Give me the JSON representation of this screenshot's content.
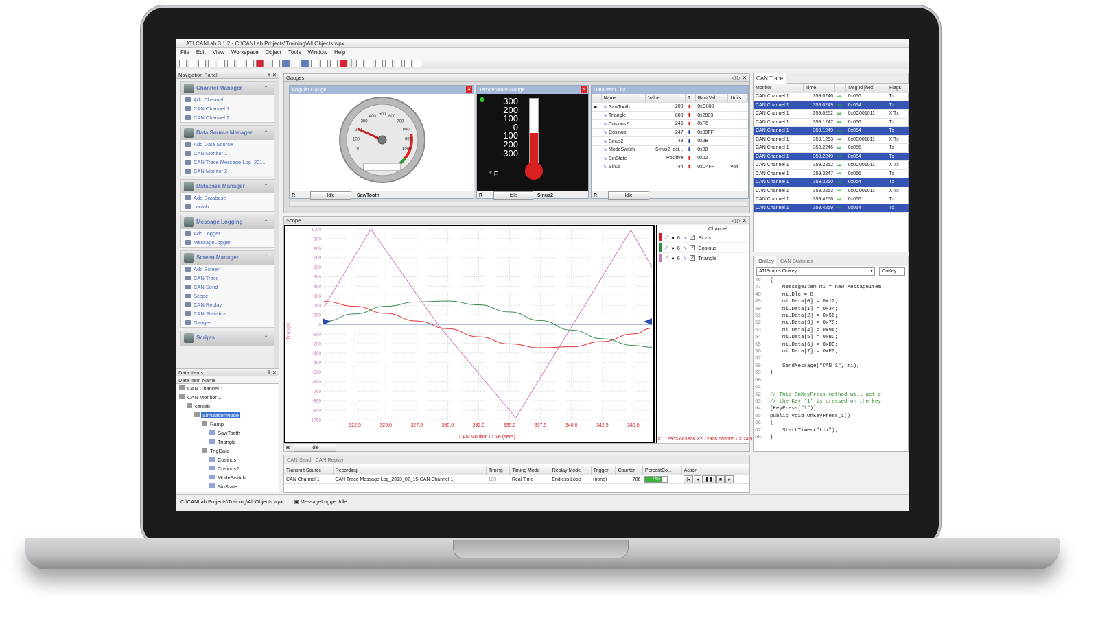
{
  "app": {
    "title": "ATI CANLab 3.1.2 - C:\\CANLab Projects\\Training\\All Objects.wpx",
    "menu": [
      "File",
      "Edit",
      "View",
      "Workspace",
      "Object",
      "Tools",
      "Window",
      "Help"
    ]
  },
  "navigation": {
    "header": "Navigation Panel",
    "sections": [
      {
        "title": "Channel Manager",
        "items": [
          "Add Channel",
          "CAN Channel 1",
          "CAN Channel 2"
        ]
      },
      {
        "title": "Data Source Manager",
        "items": [
          "Add Data Source",
          "CAN Monitor 1",
          "CAN Trace Message Log_201...",
          "CAN Monitor 2"
        ]
      },
      {
        "title": "Database Manager",
        "items": [
          "Add Database",
          "canlab"
        ]
      },
      {
        "title": "Message Logging",
        "items": [
          "Add Logger",
          "MessageLogger"
        ]
      },
      {
        "title": "Screen Manager",
        "items": [
          "Add Screen",
          "CAN Trace",
          "CAN Send",
          "Scope",
          "CAN Replay",
          "CAN Statistics",
          "Gauges"
        ]
      },
      {
        "title": "Scripts",
        "items": []
      }
    ]
  },
  "data_items": {
    "header": "Data Items",
    "column": "Data Item Name",
    "rows": [
      {
        "label": "CAN Channel 1",
        "indent": 0
      },
      {
        "label": "CAN Monitor 1",
        "indent": 0
      },
      {
        "label": "canlab",
        "indent": 1
      },
      {
        "label": "SimulationNode",
        "indent": 2,
        "selected": true
      },
      {
        "label": "Ramp",
        "indent": 3
      },
      {
        "label": "SawTooth",
        "indent": 4
      },
      {
        "label": "Triangle",
        "indent": 4
      },
      {
        "label": "TrigData",
        "indent": 3
      },
      {
        "label": "Cosinus",
        "indent": 4
      },
      {
        "label": "Cosinus2",
        "indent": 4
      },
      {
        "label": "ModeSwitch",
        "indent": 4
      },
      {
        "label": "SinState",
        "indent": 4
      }
    ]
  },
  "gauges": {
    "tab": "Gauges",
    "angular": {
      "title": "Angular Gauge",
      "status_r": "R",
      "status": "Idle",
      "signal": "SawTooth",
      "ticks": [
        "0",
        "100",
        "200",
        "300",
        "400",
        "500",
        "600",
        "700",
        "800",
        "900",
        "1000"
      ],
      "value_fraction": 0.2
    },
    "temperature": {
      "title": "Temperature Gauge",
      "status_r": "R",
      "status": "Idle",
      "signal": "Sinus2",
      "scale": [
        "300",
        "200",
        "100",
        "0",
        "-100",
        "-200",
        "-300"
      ],
      "unit": "° F",
      "value_fraction": 0.58
    },
    "data_item_list": {
      "title": "Data Item List",
      "columns": [
        "Name",
        "Value",
        "T",
        "Raw Val...",
        "Units"
      ],
      "rows": [
        {
          "name": "SawTooth",
          "value": "200",
          "dir": "up",
          "raw": "0xC800",
          "units": ""
        },
        {
          "name": "Triangle",
          "value": "800",
          "dir": "up",
          "raw": "0x2003",
          "units": ""
        },
        {
          "name": "Cosinus2",
          "value": "246",
          "dir": "up",
          "raw": "0xF6",
          "units": ""
        },
        {
          "name": "Cosinus",
          "value": "-247",
          "dir": "down",
          "raw": "0x09FF",
          "units": ""
        },
        {
          "name": "Sinus2",
          "value": "43",
          "dir": "down",
          "raw": "0x2B",
          "units": ""
        },
        {
          "name": "ModeSwitch",
          "value": "Sinus2_act...",
          "dir": "down",
          "raw": "0x00",
          "units": ""
        },
        {
          "name": "SinState",
          "value": "Positive",
          "dir": "up",
          "raw": "0x02",
          "units": ""
        },
        {
          "name": "Sinus",
          "value": "-44",
          "dir": "up",
          "raw": "0xD4FF",
          "units": "Volt"
        }
      ],
      "status_r": "R",
      "status": "Idle"
    }
  },
  "scope": {
    "title": "Scope",
    "y_label": "Triangle",
    "x_label": "CAN Monitor 1 Live (secs)",
    "cursor_text": "X1:12903.663328 X2:12928.665665 dX:24.9",
    "status_r": "R",
    "status": "Idle",
    "legend_header": "Channel",
    "legend": [
      {
        "name": "Sinus",
        "color": "#d4202a",
        "width": "6"
      },
      {
        "name": "Cosinus",
        "color": "#2f8a3a",
        "width": "6"
      },
      {
        "name": "Triangle",
        "color": "#c878b8",
        "width": "6"
      }
    ]
  },
  "chart_data": {
    "type": "line",
    "x_ticks": [
      "322.5",
      "325.0",
      "327.5",
      "330.0",
      "332.5",
      "335.0",
      "337.5",
      "340.0",
      "342.5",
      "345.0"
    ],
    "y_ticks": [
      "1000",
      "900",
      "800",
      "700",
      "600",
      "500",
      "400",
      "300",
      "200",
      "100",
      "0",
      "-100",
      "-200",
      "-300",
      "-400",
      "-500",
      "-600",
      "-700",
      "-800",
      "-900",
      "-1000"
    ],
    "xlim": [
      320.0,
      346.5
    ],
    "ylim": [
      -1000,
      1000
    ],
    "series": [
      {
        "name": "Sinus",
        "color": "#e0363a",
        "x": [
          320.0,
          322.5,
          325.0,
          327.5,
          330.0,
          332.5,
          335.0,
          337.5,
          340.0,
          342.5,
          345.0,
          346.5
        ],
        "values": [
          240,
          190,
          115,
          35,
          -45,
          -130,
          -205,
          -245,
          -235,
          -180,
          -100,
          -40
        ]
      },
      {
        "name": "Cosinus",
        "color": "#3b8d4e",
        "x": [
          320.0,
          322.5,
          325.0,
          327.5,
          330.0,
          332.5,
          335.0,
          337.5,
          340.0,
          342.5,
          345.0,
          346.5
        ],
        "values": [
          30,
          110,
          190,
          235,
          245,
          205,
          130,
          40,
          -60,
          -150,
          -220,
          -240
        ]
      },
      {
        "name": "Triangle",
        "color": "#cf7ac1",
        "x": [
          320.0,
          323.8,
          329.2,
          335.5,
          344.8,
          346.5
        ],
        "values": [
          180,
          1000,
          0,
          -980,
          990,
          600
        ]
      }
    ]
  },
  "can_send": {
    "tabs": [
      "CAN Send",
      "CAN Replay"
    ],
    "columns": [
      "Transmit Source",
      "Recording",
      "Timing",
      "Timing Mode",
      "Replay Mode",
      "Trigger",
      "Counter",
      "PercentCo...",
      "Action"
    ],
    "row": {
      "source": "CAN Channel 1",
      "recording": "CAN Trace Message Log_2013_02_15(CAN Channel 1)",
      "timing": "100",
      "timing_mode": "Real Time",
      "replay_mode": "Endless Loop",
      "trigger": "(none)",
      "counter": "786",
      "percent": "74%",
      "percent_value": 0.74
    }
  },
  "can_trace": {
    "tab": "CAN Trace",
    "columns": [
      "Monitor",
      "Time",
      "T",
      "Msg Id [hex]",
      "Flags"
    ],
    "rows": [
      {
        "monitor": "CAN Channel 1",
        "time": "359.0246",
        "id": "0x066",
        "flags": "Tx",
        "hl": false
      },
      {
        "monitor": "CAN Channel 1",
        "time": "359.0249",
        "id": "0x064",
        "flags": "Tx",
        "hl": true
      },
      {
        "monitor": "CAN Channel 1",
        "time": "359.0252",
        "id": "0x0C001011",
        "flags": "X Tx",
        "hl": false
      },
      {
        "monitor": "CAN Channel 1",
        "time": "359.1247",
        "id": "0x066",
        "flags": "Tx",
        "hl": false
      },
      {
        "monitor": "CAN Channel 1",
        "time": "359.1249",
        "id": "0x064",
        "flags": "Tx",
        "hl": true
      },
      {
        "monitor": "CAN Channel 1",
        "time": "359.1253",
        "id": "0x0C001011",
        "flags": "X Tx",
        "hl": false
      },
      {
        "monitor": "CAN Channel 1",
        "time": "359.2246",
        "id": "0x066",
        "flags": "Tx",
        "hl": false
      },
      {
        "monitor": "CAN Channel 1",
        "time": "359.2249",
        "id": "0x064",
        "flags": "Tx",
        "hl": true
      },
      {
        "monitor": "CAN Channel 1",
        "time": "359.2252",
        "id": "0x0C001011",
        "flags": "X Tx",
        "hl": false
      },
      {
        "monitor": "CAN Channel 1",
        "time": "359.3247",
        "id": "0x066",
        "flags": "Tx",
        "hl": false
      },
      {
        "monitor": "CAN Channel 1",
        "time": "359.3250",
        "id": "0x064",
        "flags": "Tx",
        "hl": true
      },
      {
        "monitor": "CAN Channel 1",
        "time": "359.3253",
        "id": "0x0C001011",
        "flags": "X Tx",
        "hl": false
      },
      {
        "monitor": "CAN Channel 1",
        "time": "359.4256",
        "id": "0x066",
        "flags": "Tx",
        "hl": false
      },
      {
        "monitor": "CAN Channel 1",
        "time": "359.4259",
        "id": "0x064",
        "flags": "Tx",
        "hl": true
      }
    ]
  },
  "script_editor": {
    "tabs": [
      "OnKey",
      "CAN Statistics"
    ],
    "dropdown": "ATIScripts.OnKey",
    "dropdown2": "OnKey",
    "lines": [
      {
        "n": "46",
        "t": "{"
      },
      {
        "n": "47",
        "t": "    MessageItem mi = new MessageItem"
      },
      {
        "n": "48",
        "t": "    mi.Dlc = 8;"
      },
      {
        "n": "49",
        "t": "    mi.Data[0] = 0x12;"
      },
      {
        "n": "50",
        "t": "    mi.Data[1] = 0x34;"
      },
      {
        "n": "51",
        "t": "    mi.Data[2] = 0x56;"
      },
      {
        "n": "52",
        "t": "    mi.Data[3] = 0x78;"
      },
      {
        "n": "53",
        "t": "    mi.Data[4] = 0x9A;"
      },
      {
        "n": "54",
        "t": "    mi.Data[5] = 0xBC;"
      },
      {
        "n": "55",
        "t": "    mi.Data[6] = 0xDE;"
      },
      {
        "n": "56",
        "t": "    mi.Data[7] = 0xF0;"
      },
      {
        "n": "57",
        "t": ""
      },
      {
        "n": "58",
        "t": "    SendMessage(\"CAN 1\", mi);"
      },
      {
        "n": "59",
        "t": "}"
      },
      {
        "n": "60",
        "t": ""
      },
      {
        "n": "61",
        "t": ""
      },
      {
        "n": "62",
        "t": "// This OnKeyPress method will get c"
      },
      {
        "n": "63",
        "t": "// the Key '1' is pressed on the key"
      },
      {
        "n": "64",
        "t": "[KeyPress(\"1\")]"
      },
      {
        "n": "65",
        "t": "public void OnKeyPress_1()"
      },
      {
        "n": "66",
        "t": "{"
      },
      {
        "n": "67",
        "t": "    StartTimer(\"tim\");"
      },
      {
        "n": "68",
        "t": "}"
      }
    ]
  },
  "status_bar": {
    "path": "C:\\CANLab Projects\\Training\\All Objects.wpx",
    "logger": "MessageLogger Idle"
  }
}
